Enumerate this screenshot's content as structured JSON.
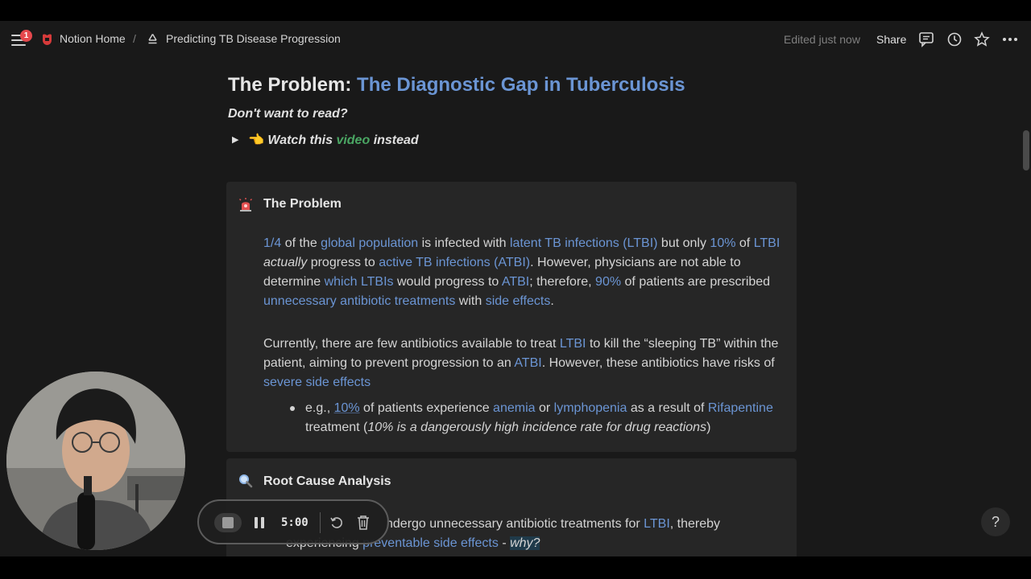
{
  "topbar": {
    "notification_count": "1",
    "workspace_label": "Notion Home",
    "separator": "/",
    "page_label": "Predicting TB Disease Progression",
    "edited_text": "Edited just now",
    "share_label": "Share"
  },
  "heading": {
    "prefix": "The Problem:",
    "suffix": "The Diagnostic Gap in Tuberculosis"
  },
  "subheading": "Don't want to read?",
  "toggle": {
    "emoji": "👈",
    "t1": "Watch this",
    "t2": "video",
    "t3": "instead"
  },
  "callout1": {
    "title": "The Problem",
    "p1": {
      "a": "1/4",
      "b": " of the ",
      "c": "global population",
      "d": " is infected with ",
      "e": "latent TB infections (LTBI)",
      "f": " but only ",
      "g": "10%",
      "h": " of ",
      "i": "LTBI",
      "j": " ",
      "k": "actually",
      "l": " progress to ",
      "m": "active TB infections (ATBI)",
      "n": ". However, physicians are not able to determine ",
      "o": "which LTBIs",
      "p": " would progress to ",
      "q": "ATBI",
      "r": "; therefore, ",
      "s": "90%",
      "t": " of patients are prescribed ",
      "u": "unnecessary antibiotic treatments",
      "v": " with ",
      "w": "side effects",
      "x": "."
    },
    "p2": {
      "a": "Currently, there are few antibiotics available to treat ",
      "b": "LTBI",
      "c": " to kill the “sleeping TB” within the patient, aiming to prevent progression to an ",
      "d": "ATBI",
      "e": ". However, these antibiotics have risks of ",
      "f": "severe side effects"
    },
    "bullet": {
      "a": "e.g., ",
      "b": "10%",
      "c": " of patients experience ",
      "d": "anemia",
      "e": " or ",
      "f": "lymphopenia",
      "g": " as a result of ",
      "h": "Rifapentine",
      "i": " treatment (",
      "j": "10% is a dangerously high incidence rate for drug reactions",
      "k": ")"
    }
  },
  "callout2": {
    "title": "Root Cause Analysis",
    "line1": {
      "a": "ndergo unnecessary antibiotic treatments for ",
      "b": "LTBI",
      "c": ", thereby"
    },
    "line2": {
      "a": "experiencing ",
      "b": "preventable side effects",
      "c": " - ",
      "d": "why?"
    }
  },
  "recorder": {
    "time": "5:00"
  },
  "help_label": "?",
  "icons": {
    "menu": "menu-icon",
    "notion": "notion-logo-icon",
    "recycle": "recycle-icon",
    "comment": "comment-icon",
    "history": "clock-history-icon",
    "favorite": "star-icon",
    "more": "more-icon",
    "siren": "siren-icon",
    "search": "magnifier-icon"
  },
  "colors": {
    "background": "#191919",
    "callout_bg": "#262626",
    "link": "#6b95d4",
    "green": "#4aa663",
    "badge": "#e5484d"
  }
}
